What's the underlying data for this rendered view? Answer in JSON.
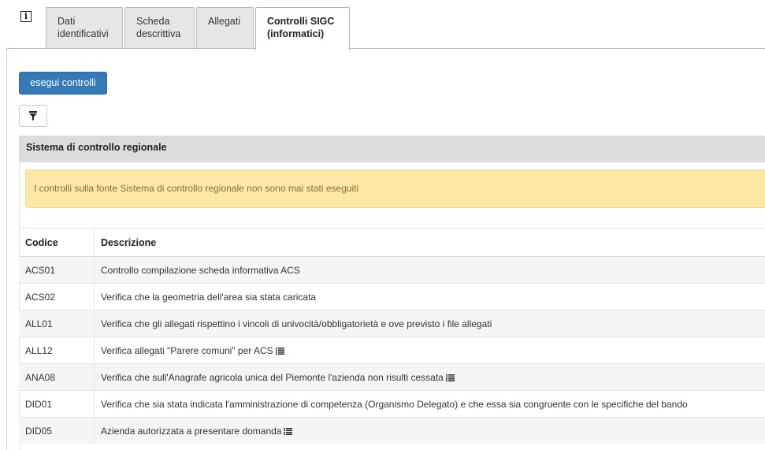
{
  "tabs": [
    {
      "label_line1": "Dati",
      "label_line2": "identificativi",
      "active": false
    },
    {
      "label_line1": "Scheda",
      "label_line2": "descrittiva",
      "active": false
    },
    {
      "label_line1": "Allegati",
      "label_line2": "",
      "active": false
    },
    {
      "label_line1": "Controlli SIGC",
      "label_line2": "(informatici)",
      "active": true
    }
  ],
  "info_icon": "info-icon",
  "toolbar": {
    "run_label": "esegui controlli",
    "filter_icon": "filter-icon"
  },
  "panel": {
    "title": "Sistema di controllo regionale",
    "alert": "I controlli sulla fonte Sistema di controllo regionale non sono mai stati eseguiti"
  },
  "table": {
    "headers": {
      "code": "Codice",
      "description": "Descrizione"
    },
    "rows": [
      {
        "code": "ACS01",
        "description": "Controllo compilazione scheda informativa ACS",
        "has_list_icon": false
      },
      {
        "code": "ACS02",
        "description": "Verifica che la geometria dell'area sia stata caricata",
        "has_list_icon": false
      },
      {
        "code": "ALL01",
        "description": "Verifica che gli allegati rispettino i vincoli di univocità/obbligatorietà e ove previsto i file allegati",
        "has_list_icon": false
      },
      {
        "code": "ALL12",
        "description": "Verifica allegati \"Parere comuni\" per ACS",
        "has_list_icon": true
      },
      {
        "code": "ANA08",
        "description": "Verifica che sull'Anagrafe agricola unica del Piemonte l'azienda non risulti cessata",
        "has_list_icon": true
      },
      {
        "code": "DID01",
        "description": "Verifica che sia stata indicata l'amministrazione di competenza (Organismo Delegato) e che essa sia congruente con le specifiche del bando",
        "has_list_icon": false
      },
      {
        "code": "DID05",
        "description": "Azienda autorizzata a presentare domanda",
        "has_list_icon": true
      }
    ]
  },
  "colors": {
    "primary_button": "#337ab7",
    "alert_background": "#fbe7a6",
    "alert_text": "#8a6d3b",
    "panel_header": "#dcdcdc"
  }
}
